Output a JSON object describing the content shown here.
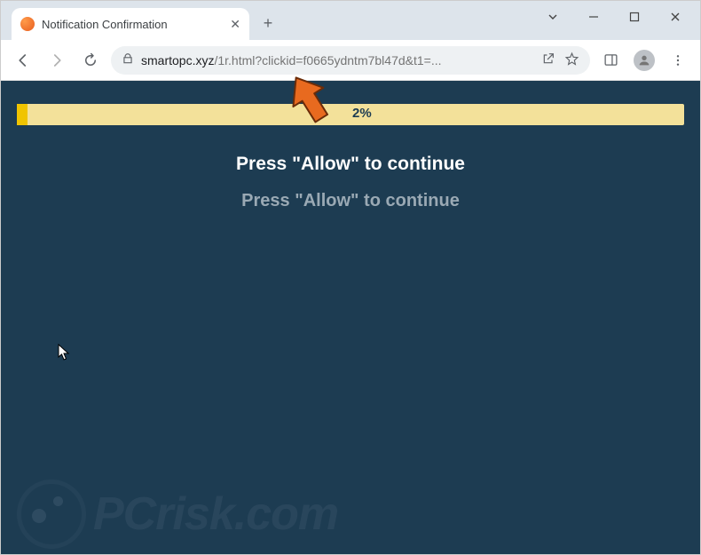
{
  "tab": {
    "title": "Notification Confirmation"
  },
  "address": {
    "domain": "smartopc.xyz",
    "path": "/1r.html?clickid=f0665ydntm7bl47d&t1=..."
  },
  "progress": {
    "percent_label": "2%"
  },
  "messages": {
    "primary": "Press \"Allow\" to continue",
    "secondary": "Press \"Allow\" to continue"
  },
  "watermark": {
    "text": "PCrisk.com"
  }
}
